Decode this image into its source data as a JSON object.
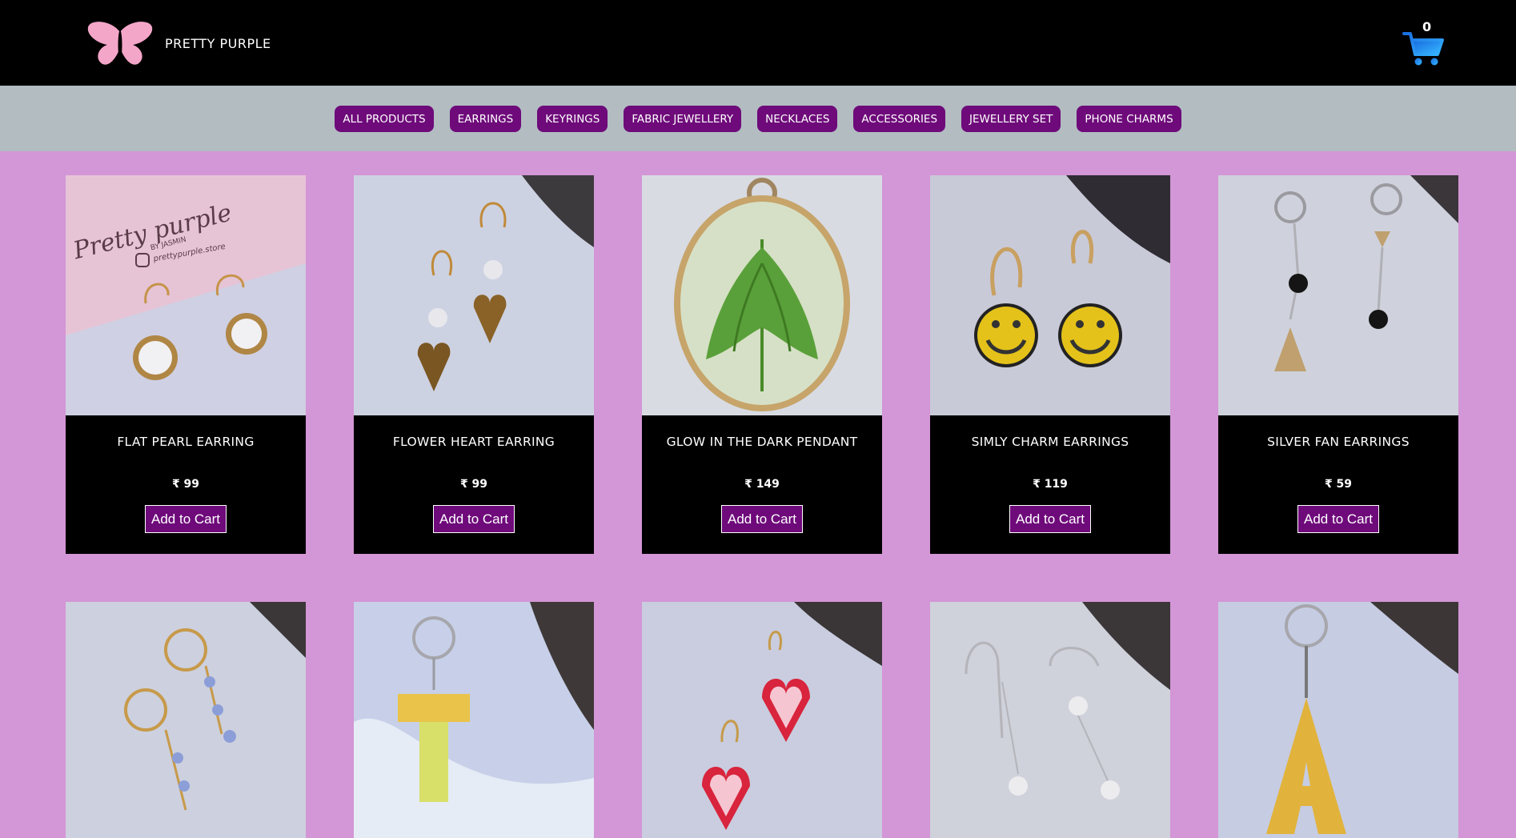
{
  "header": {
    "brand_name": "PRETTY PURPLE",
    "logo_icon": "butterfly-icon",
    "cart_icon": "shopping-cart-icon",
    "cart_count": "0"
  },
  "categories": [
    "ALL PRODUCTS",
    "EARRINGS",
    "KEYRINGS",
    "FABRIC JEWELLERY",
    "NECKLACES",
    "ACCESSORIES",
    "JEWELLERY SET",
    "PHONE CHARMS"
  ],
  "add_to_cart_label": "Add to Cart",
  "products": [
    {
      "name": "FLAT PEARL EARRING",
      "price": "₹ 99"
    },
    {
      "name": "FLOWER HEART EARRING",
      "price": "₹ 99"
    },
    {
      "name": "GLOW IN THE DARK PENDANT",
      "price": "₹ 149"
    },
    {
      "name": "SIMLY CHARM EARRINGS",
      "price": "₹ 119"
    },
    {
      "name": "SILVER FAN EARRINGS",
      "price": "₹ 59"
    }
  ],
  "colors": {
    "header_bg": "#000000",
    "category_bar_bg": "#b2bcc1",
    "page_bg": "#d396d6",
    "accent_purple": "#6e0a7a",
    "logo_pink": "#f4a6c8",
    "cart_blue": "#2a8cf0"
  }
}
